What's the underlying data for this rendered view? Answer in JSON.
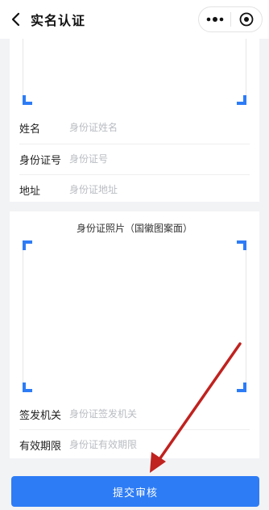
{
  "navbar": {
    "title": "实名认证",
    "back_icon": "chevron-left-icon",
    "more_icon": "more-dots-icon",
    "close_icon": "target-circle-icon"
  },
  "form": {
    "name": {
      "label": "姓名",
      "placeholder": "身份证姓名"
    },
    "id_number": {
      "label": "身份证号",
      "placeholder": "身份证号"
    },
    "address": {
      "label": "地址",
      "placeholder": "身份证地址"
    },
    "back_photo": {
      "title": "身份证照片（国徽图案面）"
    },
    "authority": {
      "label": "签发机关",
      "placeholder": "身份证签发机关"
    },
    "validity": {
      "label": "有效期限",
      "placeholder": "身份证有效期限"
    }
  },
  "submit": {
    "label": "提交审核"
  },
  "colors": {
    "accent": "#2d7cf6",
    "annotation_arrow": "#c0221f"
  }
}
